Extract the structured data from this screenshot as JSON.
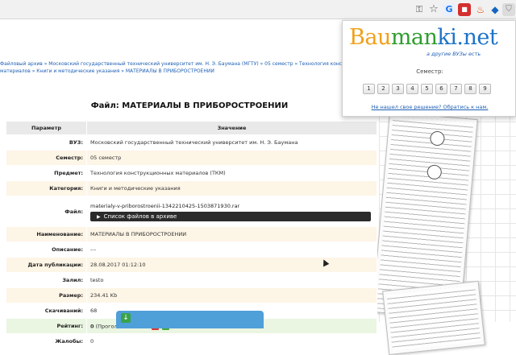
{
  "page": {
    "breadcrumb": "Файловый архив » Московский государственный технический университет им. Н. Э. Баумана (МГТУ) » 05 семестр » Технология конструкционных материалов » Книги и методические указания » МАТЕРИАЛЫ В ПРИБОРОСТРОЕНИИ",
    "title": "Файл: МАТЕРИАЛЫ В ПРИБОРОСТРОЕНИИ",
    "table": {
      "header_param": "Параметр",
      "header_value": "Значение",
      "rows": [
        {
          "label": "ВУЗ:",
          "value": "Московский государственный технический университет им. Н. Э. Баумана"
        },
        {
          "label": "Семестр:",
          "value": "05 семестр"
        },
        {
          "label": "Предмет:",
          "value": "Технология конструкционных материалов (ТКМ)"
        },
        {
          "label": "Категория:",
          "value": "Книги и методические указания"
        },
        {
          "label": "Файл:",
          "value": "materialy-v-priborostroenii-1342210425-1503871930.rar"
        },
        {
          "label": "Наименование:",
          "value": "МАТЕРИАЛЫ В ПРИБОРОСТРОЕНИИ"
        },
        {
          "label": "Описание:",
          "value": "---"
        },
        {
          "label": "Дата публикации:",
          "value": "28.08.2017 01:12:10"
        },
        {
          "label": "Залил:",
          "value": "testo"
        },
        {
          "label": "Размер:",
          "value": "234.41 Kb"
        },
        {
          "label": "Скачиваний:",
          "value": "68"
        },
        {
          "label": "Рейтинг:",
          "value_bold": "0",
          "value": " (Проголосовало: 0)"
        },
        {
          "label": "Жалобы:",
          "value": "0"
        }
      ],
      "archive_button": "Список файлов в архиве"
    }
  },
  "popup": {
    "logo_part1": "Bau",
    "logo_part2": "man",
    "logo_part3": "ki.net",
    "slogan": "а другие ВУЗы есть",
    "semester_label": "Семестр:",
    "semesters": [
      "1",
      "2",
      "3",
      "4",
      "5",
      "6",
      "7",
      "8",
      "9"
    ],
    "help_link": "Не нашел свое решение? Обратись к нам."
  },
  "icons": {
    "toolbar": [
      "key-icon",
      "star-icon",
      "translate-icon",
      "red-extension-icon",
      "fire-extension-icon",
      "blue-extension-icon",
      "baumanki-extension-icon"
    ]
  },
  "colors": {
    "link": "#1e5fb4",
    "row_alt": "#fdf5e6",
    "row_green": "#eaf5e2",
    "archive_bar": "#2b2b2b",
    "download_button": "#4f9fd8"
  }
}
